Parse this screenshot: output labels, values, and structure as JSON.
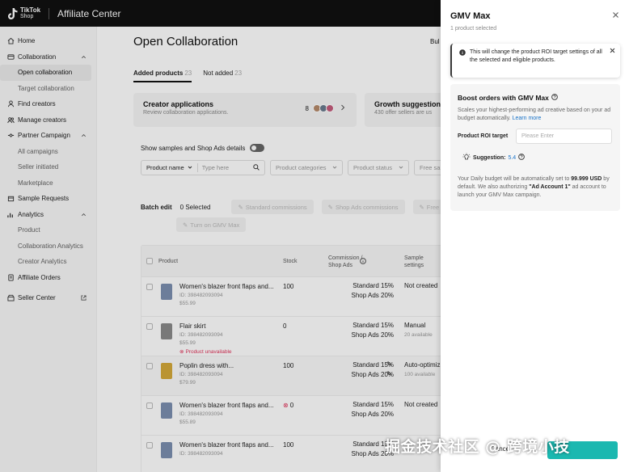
{
  "header": {
    "logo_line1": "TikTok",
    "logo_line2": "Shop",
    "app_title": "Affiliate Center"
  },
  "sidebar": {
    "items": [
      {
        "label": "Home",
        "icon": "home-icon"
      },
      {
        "label": "Collaboration",
        "icon": "collab-icon",
        "expanded": true
      },
      {
        "label": "Open collaboration",
        "sub": true,
        "active": true
      },
      {
        "label": "Target collaboration",
        "sub": true
      },
      {
        "label": "Find creators",
        "icon": "person-icon"
      },
      {
        "label": "Manage creators",
        "icon": "people-icon"
      },
      {
        "label": "Partner Campaign",
        "icon": "partner-icon",
        "expanded": true
      },
      {
        "label": "All campaigns",
        "sub": true
      },
      {
        "label": "Seller initiated",
        "sub": true
      },
      {
        "label": "Marketplace",
        "sub": true
      },
      {
        "label": "Sample Requests",
        "icon": "box-icon"
      },
      {
        "label": "Analytics",
        "icon": "chart-icon",
        "expanded": true
      },
      {
        "label": "Product",
        "sub": true
      },
      {
        "label": "Collaboration Analytics",
        "sub": true
      },
      {
        "label": "Creator Analytics",
        "sub": true
      },
      {
        "label": "Affiliate Orders",
        "icon": "orders-icon"
      },
      {
        "label": "Seller Center",
        "icon": "store-icon"
      }
    ]
  },
  "main": {
    "title": "Open Collaboration",
    "bulk_label": "Bul",
    "tabs": [
      {
        "label": "Added products",
        "count": "23"
      },
      {
        "label": "Not added",
        "count": "23"
      }
    ],
    "cards": [
      {
        "title": "Creator applications",
        "desc": "Review collaboration applications.",
        "count": "8"
      },
      {
        "title": "Growth suggestions",
        "desc": "430 offer sellers are us"
      }
    ],
    "toggle_label": "Show samples and Shop Ads details",
    "filters": {
      "product_name": "Product name",
      "search_placeholder": "Type here",
      "categories": "Product categories",
      "status": "Product status",
      "more": "Free sa"
    },
    "batch": {
      "label": "Batch edit",
      "selected": "0 Selected",
      "buttons": [
        "Standard commissions",
        "Shop Ads commissions",
        "Free sa"
      ],
      "gmv_button": "Turn on GMV Max"
    },
    "table": {
      "headers": {
        "product": "Product",
        "stock": "Stock",
        "commission": "Commission / Shop Ads",
        "sample": "Sample settings"
      },
      "rows": [
        {
          "name": "Women's blazer front flaps and...",
          "id": "ID: 398482093094",
          "price": "$55.99",
          "stock": "100",
          "comm1": "Standard 15%",
          "comm2": "Shop Ads 20%",
          "sample": "Not created",
          "sample_sub": "",
          "img_color": "#7b8fb0"
        },
        {
          "name": "Flair skirt",
          "id": "ID: 398482093094",
          "price": "$55.99",
          "stock": "0",
          "comm1": "Standard 15%",
          "comm2": "Shop Ads 20%",
          "sample": "Manual",
          "sample_sub": "20 available",
          "unavailable": "Product unavailable",
          "img_color": "#8a8a8a"
        },
        {
          "name": "Poplin dress with...",
          "id": "ID: 398482093094",
          "price": "$79.99",
          "stock": "100",
          "comm1": "Standard 15%",
          "comm2": "Shop Ads 20%",
          "sample": "Auto-optimiz",
          "sample_sub": "100 available",
          "img_color": "#d4a93a"
        },
        {
          "name": "Women's blazer front flaps and...",
          "id": "ID: 398482093094",
          "price": "$55.89",
          "stock": "0",
          "comm1": "Standard 15%",
          "comm2": "Shop Ads 20%",
          "sample": "Not created",
          "sample_sub": "",
          "img_color": "#7b8fb0"
        },
        {
          "name": "Women's blazer front flaps and...",
          "id": "ID: 398482093094",
          "price": "",
          "stock": "100",
          "comm1": "Standard 15%",
          "comm2": "Shop Ads 20%",
          "sample": "",
          "sample_sub": "",
          "img_color": "#7b8fb0"
        }
      ]
    }
  },
  "drawer": {
    "title": "GMV Max",
    "subtitle": "1 product selected",
    "alert": "This will change the product ROI target settings of all the selected and eligible products.",
    "boost_title": "Boost orders with GMV Max",
    "boost_desc": "Scales your highest-performing ad creative based on your ad budget automatically.",
    "learn_more": "Learn more",
    "roi_label": "Product ROI target",
    "roi_placeholder": "Please Enter",
    "suggestion_label": "Suggestion:",
    "suggestion_value": "5.4",
    "budget_pre": "Your Daily budget will be automatically set to ",
    "budget_amount": "99.999 USD",
    "budget_mid": " by default. We also authorizing ",
    "budget_account": "\"Ad Account 1\"",
    "budget_post": " ad account to launch your GMV Max campaign.",
    "cancel": "Cancel"
  },
  "watermark": "掘金技术社区 @ 跨境小技",
  "colors": {
    "accent": "#1bb8b0",
    "link": "#1a73c8",
    "error": "#e0335a"
  }
}
